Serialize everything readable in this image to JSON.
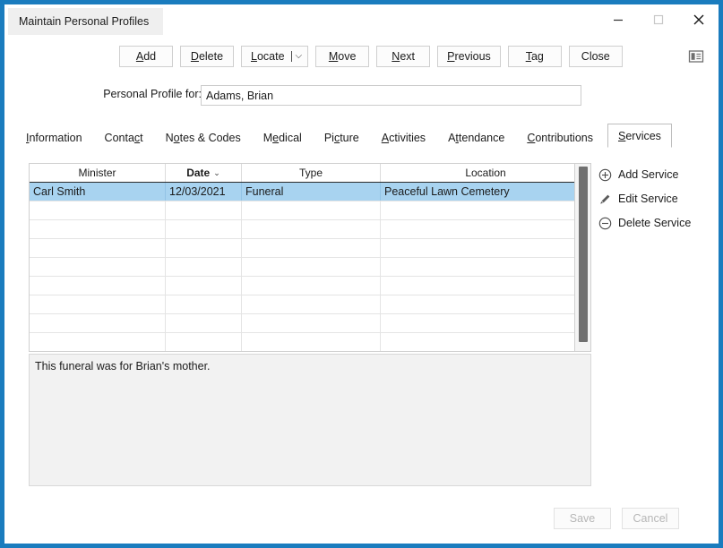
{
  "window": {
    "title": "Maintain Personal Profiles",
    "controls": {
      "minimize": "minimize-icon",
      "maximize": "maximize-icon",
      "close": "close-icon"
    },
    "border_color": "#1a7cbe"
  },
  "toolbar": {
    "buttons": [
      {
        "label": "Add",
        "mnemonic": "A",
        "split": false
      },
      {
        "label": "Delete",
        "mnemonic": "D",
        "split": false
      },
      {
        "label": "Locate",
        "mnemonic": "L",
        "split": true
      },
      {
        "label": "Move",
        "mnemonic": "M",
        "split": false
      },
      {
        "label": "Next",
        "mnemonic": "N",
        "split": false
      },
      {
        "label": "Previous",
        "mnemonic": "P",
        "split": false
      },
      {
        "label": "Tag",
        "mnemonic": "T",
        "split": false
      },
      {
        "label": "Close",
        "mnemonic": "",
        "split": false
      }
    ],
    "panel_toggle_icon": "panel-layout-icon"
  },
  "profile": {
    "label": "Personal Profile for:",
    "value": "Adams, Brian",
    "placeholder": ""
  },
  "tabs": {
    "items": [
      {
        "label": "Information",
        "mnemonic": "I",
        "active": false
      },
      {
        "label": "Contact",
        "mnemonic": "c",
        "active": false
      },
      {
        "label": "Notes & Codes",
        "mnemonic": "o",
        "active": false
      },
      {
        "label": "Medical",
        "mnemonic": "e",
        "active": false
      },
      {
        "label": "Picture",
        "mnemonic": "c",
        "active": false
      },
      {
        "label": "Activities",
        "mnemonic": "A",
        "active": false
      },
      {
        "label": "Attendance",
        "mnemonic": "t",
        "active": false
      },
      {
        "label": "Contributions",
        "mnemonic": "C",
        "active": false
      },
      {
        "label": "Services",
        "mnemonic": "S",
        "active": true
      }
    ]
  },
  "grid": {
    "columns": [
      {
        "label": "Minister",
        "sorted": false,
        "sort_caret": ""
      },
      {
        "label": "Date",
        "sorted": true,
        "sort_caret": "⌄"
      },
      {
        "label": "Type",
        "sorted": false,
        "sort_caret": ""
      },
      {
        "label": "Location",
        "sorted": false,
        "sort_caret": ""
      }
    ],
    "rows": [
      {
        "minister": "Carl Smith",
        "date": "12/03/2021",
        "type": "Funeral",
        "location": "Peaceful Lawn Cemetery",
        "selected": true
      },
      {
        "minister": "",
        "date": "",
        "type": "",
        "location": "",
        "selected": false
      },
      {
        "minister": "",
        "date": "",
        "type": "",
        "location": "",
        "selected": false
      },
      {
        "minister": "",
        "date": "",
        "type": "",
        "location": "",
        "selected": false
      },
      {
        "minister": "",
        "date": "",
        "type": "",
        "location": "",
        "selected": false
      },
      {
        "minister": "",
        "date": "",
        "type": "",
        "location": "",
        "selected": false
      },
      {
        "minister": "",
        "date": "",
        "type": "",
        "location": "",
        "selected": false
      },
      {
        "minister": "",
        "date": "",
        "type": "",
        "location": "",
        "selected": false
      },
      {
        "minister": "",
        "date": "",
        "type": "",
        "location": "",
        "selected": false
      }
    ],
    "selection_color": "#a8d3f0"
  },
  "actions": [
    {
      "label": "Add Service",
      "icon": "circle-plus-icon"
    },
    {
      "label": "Edit Service",
      "icon": "pencil-icon"
    },
    {
      "label": "Delete Service",
      "icon": "circle-minus-icon"
    }
  ],
  "notes": {
    "value": "This funeral was for Brian's mother.",
    "placeholder": ""
  },
  "footer": {
    "save_label": "Save",
    "cancel_label": "Cancel",
    "save_enabled": false,
    "cancel_enabled": false
  }
}
